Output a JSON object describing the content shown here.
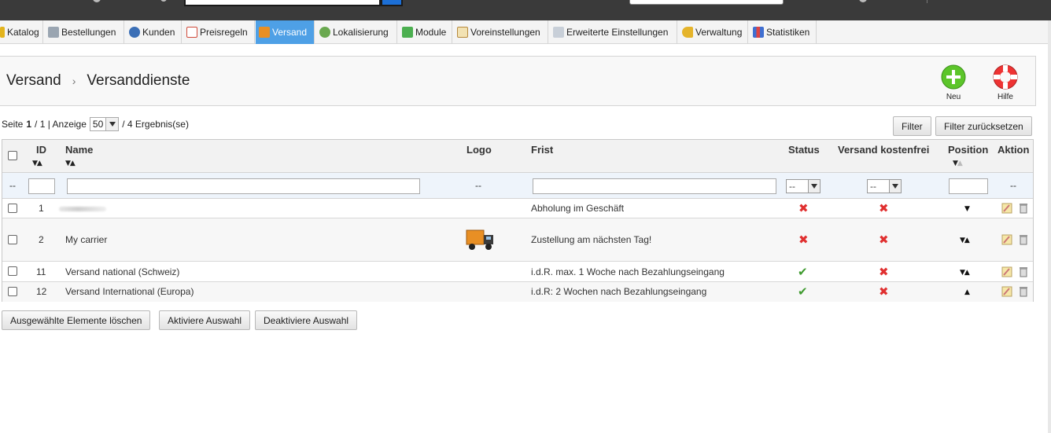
{
  "nav": {
    "tabs": [
      {
        "label": "Katalog",
        "icon": "catalog-icon",
        "color": "#e3b41d"
      },
      {
        "label": "Bestellungen",
        "icon": "cart-icon",
        "color": "#7b8794"
      },
      {
        "label": "Kunden",
        "icon": "customers-icon",
        "color": "#3b6fb6"
      },
      {
        "label": "Preisregeln",
        "icon": "price-rules-icon",
        "color": "#d04a3a"
      },
      {
        "label": "Versand",
        "icon": "truck-icon",
        "color": "#e88f24"
      },
      {
        "label": "Lokalisierung",
        "icon": "globe-icon",
        "color": "#6aa84f"
      },
      {
        "label": "Module",
        "icon": "puzzle-icon",
        "color": "#4caf50"
      },
      {
        "label": "Voreinstellungen",
        "icon": "preferences-icon",
        "color": "#b6893c"
      },
      {
        "label": "Erweiterte Einstellungen",
        "icon": "wrench-icon",
        "color": "#8792a2"
      },
      {
        "label": "Verwaltung",
        "icon": "key-icon",
        "color": "#e5b42b"
      },
      {
        "label": "Statistiken",
        "icon": "stats-icon",
        "color": "#3f6fd1"
      }
    ]
  },
  "header": {
    "breadcrumb_parent": "Versand",
    "breadcrumb_sep": "›",
    "page_title": "Versanddienste",
    "new_label": "Neu",
    "help_label": "Hilfe"
  },
  "pager": {
    "page_prefix": "Seite",
    "page_current": "1",
    "page_total": "/ 1 | Anzeige",
    "per_page": "50",
    "results": "/ 4 Ergebnis(se)"
  },
  "filter_buttons": {
    "filter": "Filter",
    "reset": "Filter zurücksetzen"
  },
  "table": {
    "columns": {
      "id": "ID",
      "name": "Name",
      "logo": "Logo",
      "delay": "Frist",
      "status": "Status",
      "free": "Versand kostenfrei",
      "position": "Position",
      "action": "Aktion"
    },
    "filter_row": {
      "dash": "--",
      "status_select": "--",
      "free_select": "--"
    },
    "rows": [
      {
        "id": "1",
        "name": "",
        "delay": "Abholung im Geschäft",
        "status": "inactive",
        "free": "no",
        "position": "down"
      },
      {
        "id": "2",
        "name": "My carrier",
        "delay": "Zustellung am nächsten Tag!",
        "status": "inactive",
        "free": "no",
        "position": "both",
        "logo": "truck-logo"
      },
      {
        "id": "11",
        "name": "Versand national (Schweiz)",
        "delay": "i.d.R. max. 1 Woche nach Bezahlungseingang",
        "status": "active",
        "free": "no",
        "position": "both"
      },
      {
        "id": "12",
        "name": "Versand International (Europa)",
        "delay": "i.d.R: 2 Wochen nach Bezahlungseingang",
        "status": "active",
        "free": "no",
        "position": "up"
      }
    ]
  },
  "bulk": {
    "delete": "Ausgewählte Elemente löschen",
    "activate": "Aktiviere Auswahl",
    "deactivate": "Deaktiviere Auswahl"
  }
}
